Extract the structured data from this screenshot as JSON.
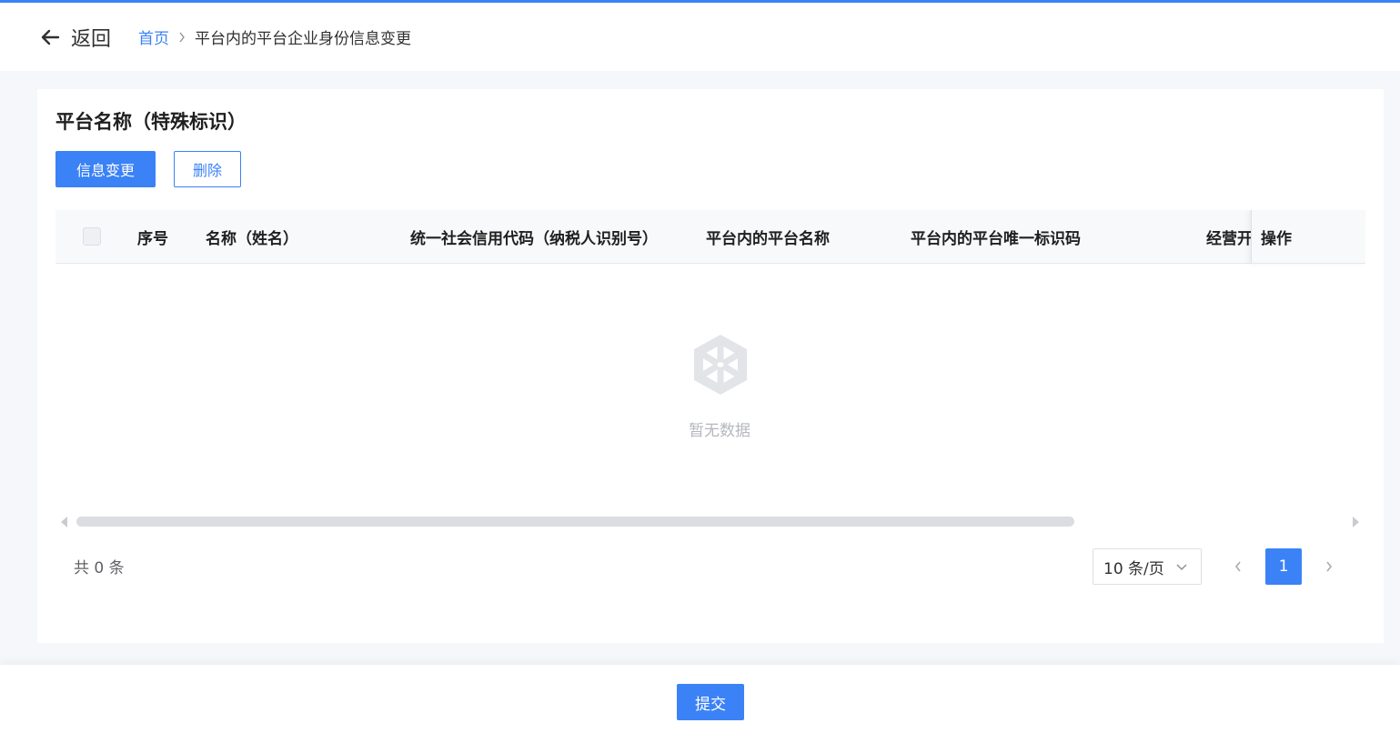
{
  "header": {
    "back_label": "返回",
    "breadcrumb_home": "首页",
    "breadcrumb_current": "平台内的平台企业身份信息变更"
  },
  "card": {
    "title": "平台名称（特殊标识）",
    "change_button": "信息变更",
    "delete_button": "删除"
  },
  "table": {
    "columns": [
      "序号",
      "名称（姓名）",
      "统一社会信用代码（纳税人识别号）",
      "平台内的平台名称",
      "平台内的平台唯一标识码",
      "经营开"
    ],
    "fixed_column": "操作",
    "empty_text": "暂无数据"
  },
  "pagination": {
    "total_text": "共 0 条",
    "page_size": "10 条/页",
    "current_page": "1"
  },
  "footer": {
    "submit_button": "提交"
  },
  "colors": {
    "primary": "#3b82f6",
    "text": "#303133",
    "muted": "#b4b7bd"
  }
}
